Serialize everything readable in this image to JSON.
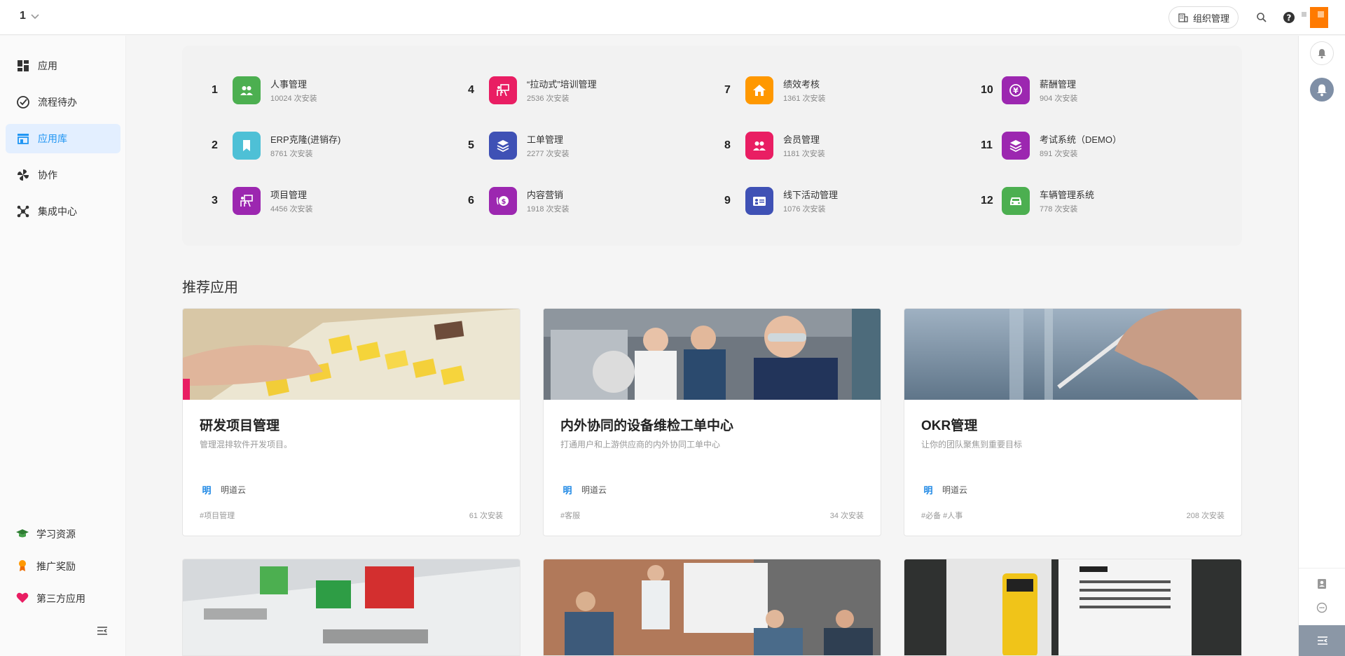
{
  "topbar": {
    "org_label": "1",
    "org_manage_label": "组织管理"
  },
  "sidebar": {
    "items": [
      {
        "label": "应用",
        "icon": "apps-grid-icon"
      },
      {
        "label": "流程待办",
        "icon": "check-circle-icon"
      },
      {
        "label": "应用库",
        "icon": "store-icon"
      },
      {
        "label": "协作",
        "icon": "pinwheel-icon"
      },
      {
        "label": "集成中心",
        "icon": "integration-icon"
      }
    ],
    "bottom": [
      {
        "label": "学习资源",
        "icon": "graduation-cap-icon"
      },
      {
        "label": "推广奖励",
        "icon": "award-icon"
      },
      {
        "label": "第三方应用",
        "icon": "heart-icon"
      }
    ]
  },
  "ranking": [
    {
      "rank": "1",
      "name": "人事管理",
      "installs": "10024 次安装",
      "color": "#4caf50",
      "icon": "people-icon"
    },
    {
      "rank": "2",
      "name": "ERP克隆(进销存)",
      "installs": "8761 次安装",
      "color": "#4ec0d6",
      "icon": "bookmark-icon"
    },
    {
      "rank": "3",
      "name": "项目管理",
      "installs": "4456 次安装",
      "color": "#9c27b0",
      "icon": "presentation-icon"
    },
    {
      "rank": "4",
      "name": "“拉动式”培训管理",
      "installs": "2536 次安装",
      "color": "#e91e63",
      "icon": "presentation-icon"
    },
    {
      "rank": "5",
      "name": "工单管理",
      "installs": "2277 次安装",
      "color": "#3f51b5",
      "icon": "layers-icon"
    },
    {
      "rank": "6",
      "name": "内容营销",
      "installs": "1918 次安装",
      "color": "#9c27b0",
      "icon": "money-icon"
    },
    {
      "rank": "7",
      "name": "绩效考核",
      "installs": "1361 次安装",
      "color": "#ff9800",
      "icon": "home-icon"
    },
    {
      "rank": "8",
      "name": "会员管理",
      "installs": "1181 次安装",
      "color": "#e91e63",
      "icon": "people-icon"
    },
    {
      "rank": "9",
      "name": "线下活动管理",
      "installs": "1076 次安装",
      "color": "#3f51b5",
      "icon": "id-card-icon"
    },
    {
      "rank": "10",
      "name": "薪酬管理",
      "installs": "904 次安装",
      "color": "#9c27b0",
      "icon": "yen-coin-icon"
    },
    {
      "rank": "11",
      "name": "考试系统（DEMO）",
      "installs": "891 次安装",
      "color": "#9c27b0",
      "icon": "layers-icon"
    },
    {
      "rank": "12",
      "name": "车辆管理系统",
      "installs": "778 次安装",
      "color": "#4caf50",
      "icon": "car-icon"
    }
  ],
  "recommended": {
    "title": "推荐应用",
    "cards": [
      {
        "title": "研发项目管理",
        "desc": "管理混排软件开发项目。",
        "author_logo": "明",
        "author": "明道云",
        "tags": "#项目管理",
        "installs": "61 次安装"
      },
      {
        "title": "内外协同的设备维检工单中心",
        "desc": "打通用户和上游供应商的内外协同工单中心",
        "author_logo": "明",
        "author": "明道云",
        "tags": "#客服",
        "installs": "34 次安装"
      },
      {
        "title": "OKR管理",
        "desc": "让你的团队聚焦到重要目标",
        "author_logo": "明",
        "author": "明道云",
        "tags": "#必备 #人事",
        "installs": "208 次安装"
      }
    ]
  },
  "colors": {
    "accent": "#2196f3",
    "active_bg": "#e3efff",
    "avatar": "#ff7a00"
  }
}
